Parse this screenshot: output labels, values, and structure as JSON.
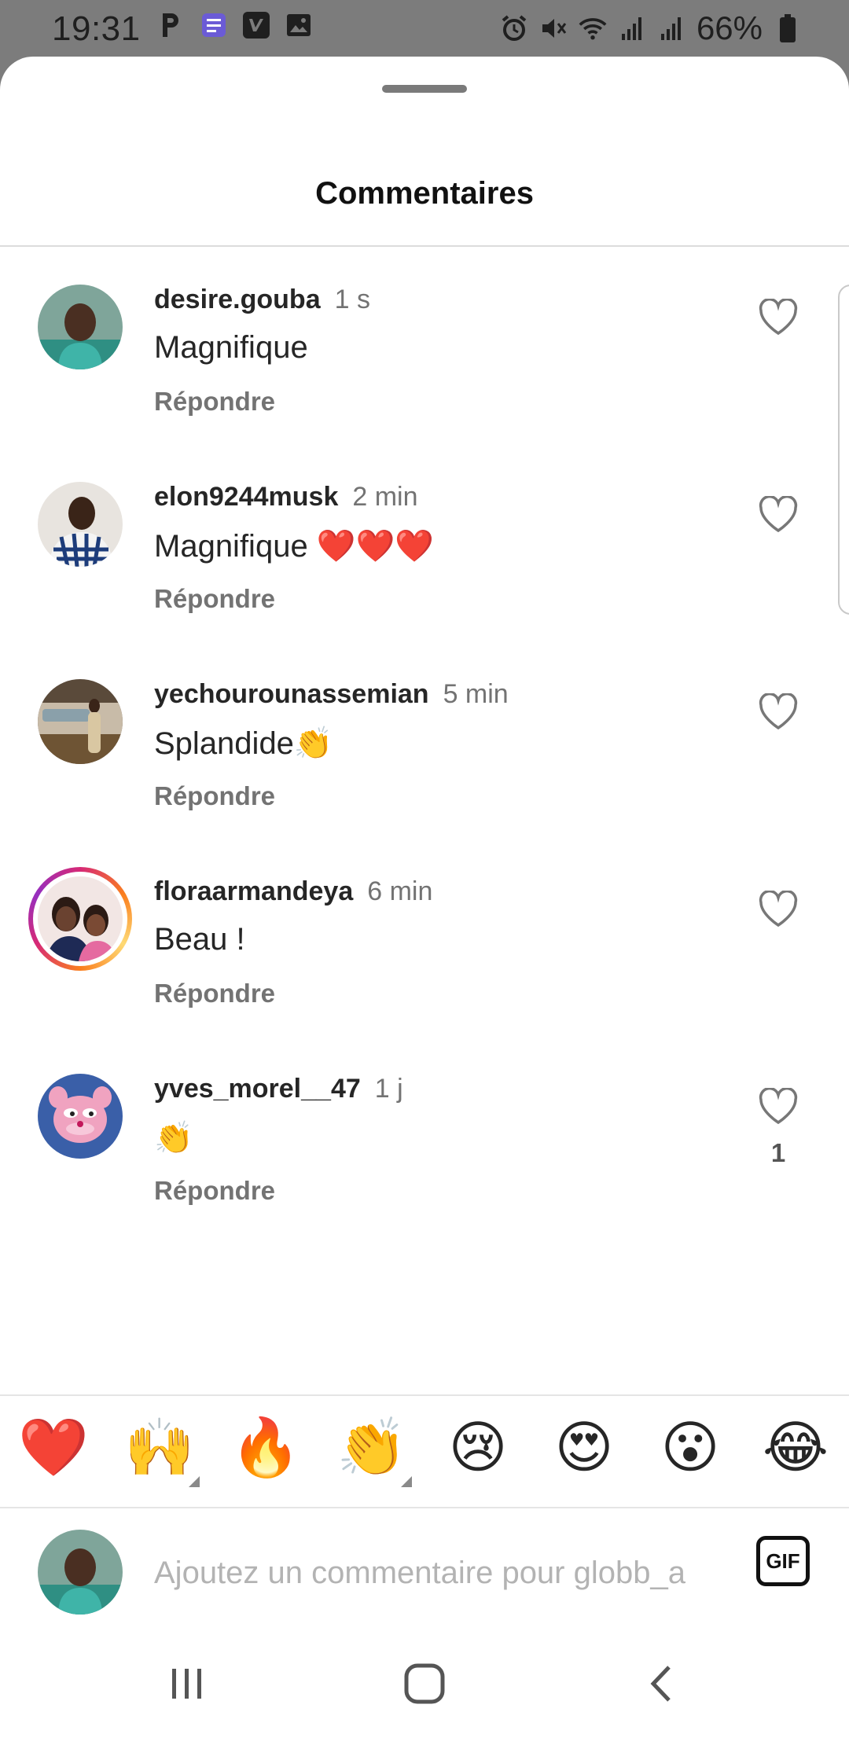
{
  "status_bar": {
    "time": "19:31",
    "battery_text": "66%",
    "left_icons": [
      "parking-p-icon",
      "notes-icon",
      "vimeo-v-icon",
      "image-icon"
    ],
    "right_icons": [
      "alarm-icon",
      "mute-icon",
      "wifi-icon",
      "signal-icon",
      "signal-icon",
      "battery-icon"
    ]
  },
  "sheet": {
    "title": "Commentaires"
  },
  "comments": [
    {
      "username": "desire.gouba",
      "time": "1 s",
      "text": "Magnifique",
      "reply_label": "Répondre",
      "likes": ""
    },
    {
      "username": "elon9244musk",
      "time": "2 min",
      "text": "Magnifique ❤️❤️❤️",
      "reply_label": "Répondre",
      "likes": ""
    },
    {
      "username": "yechourounassemian",
      "time": "5 min",
      "text": "Splandide👏",
      "reply_label": "Répondre",
      "likes": ""
    },
    {
      "username": "floraarmandeya",
      "time": "6 min",
      "text": "Beau !",
      "reply_label": "Répondre",
      "likes": ""
    },
    {
      "username": "yves_morel__47",
      "time": "1 j",
      "text": "👏",
      "reply_label": "Répondre",
      "likes": "1"
    }
  ],
  "emoji_bar": [
    "❤️",
    "🙌",
    "🔥",
    "👏",
    "😢",
    "😍",
    "😮",
    "😂"
  ],
  "input": {
    "placeholder": "Ajoutez un commentaire pour globb_a",
    "gif_label": "GIF"
  },
  "colors": {
    "muted_text": "#737373",
    "ring_start": "#d62976",
    "ring_end": "#fa7e1e"
  }
}
